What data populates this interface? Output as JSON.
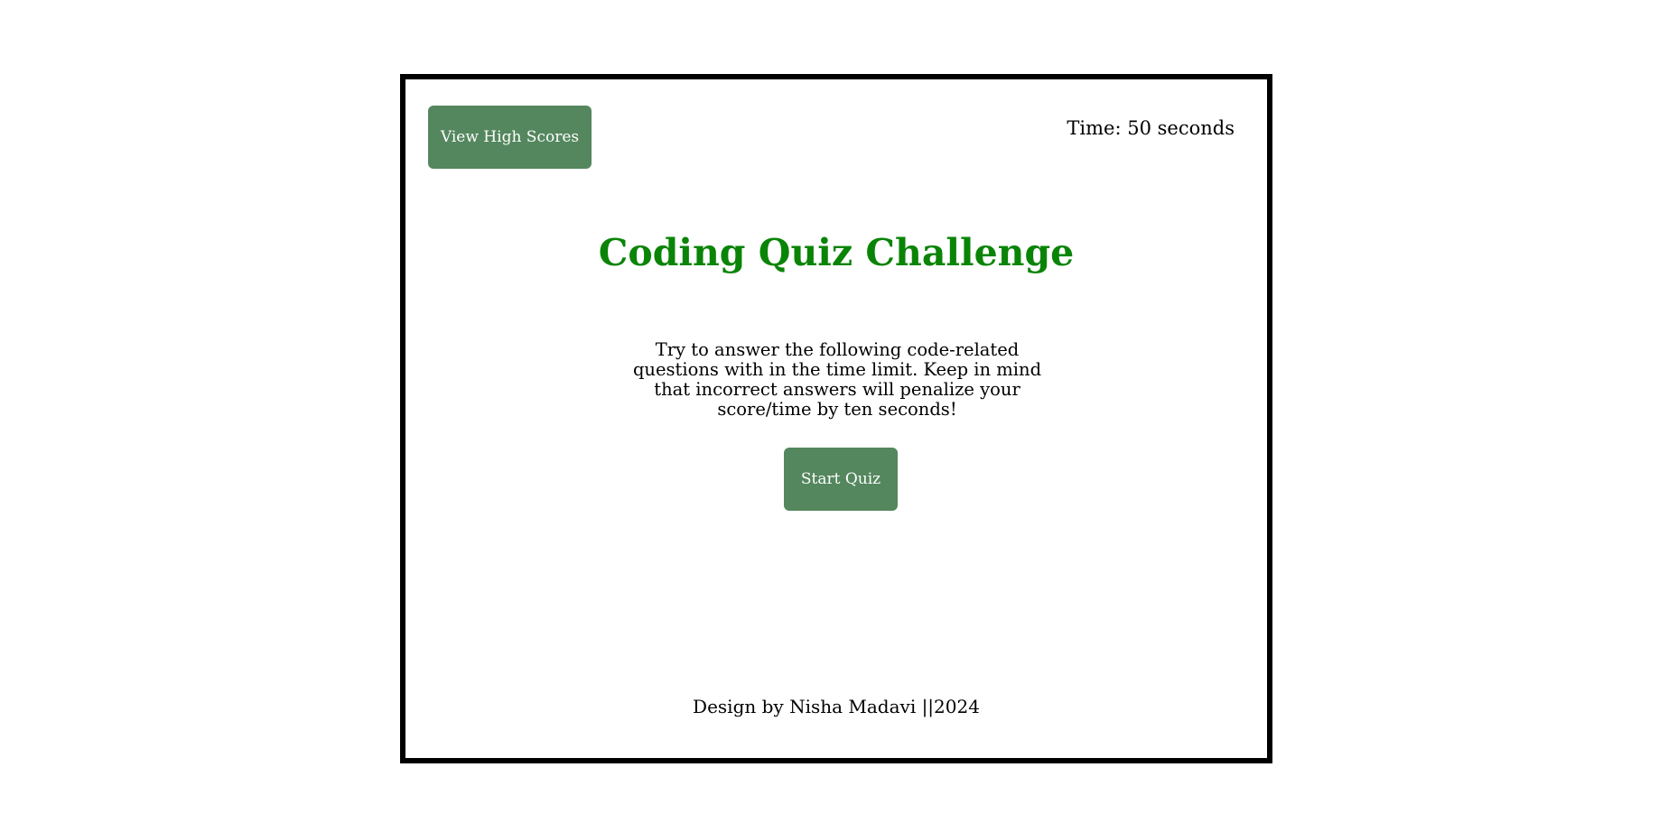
{
  "header": {
    "high_scores_label": "View High Scores",
    "timer_text": "Time: 50 seconds"
  },
  "main": {
    "title": "Coding Quiz Challenge",
    "intro": "Try to answer the following code-related questions with in the time limit. Keep in mind that incorrect answers will penalize your score/time by ten seconds!",
    "start_label": "Start Quiz"
  },
  "footer": {
    "credit": "Design by Nisha Madavi ||2024"
  },
  "colors": {
    "button_bg": "#54875e",
    "title": "#0a8407",
    "border": "#000000"
  }
}
